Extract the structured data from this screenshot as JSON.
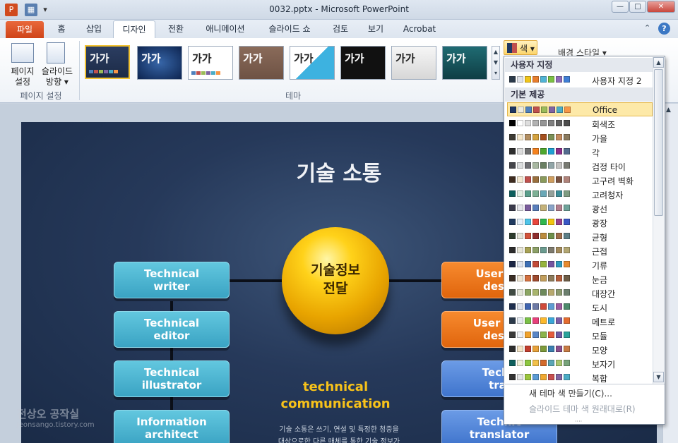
{
  "window": {
    "title": "0032.pptx  -  Microsoft PowerPoint"
  },
  "tabs": [
    {
      "label": "파일"
    },
    {
      "label": "홈"
    },
    {
      "label": "삽입"
    },
    {
      "label": "디자인"
    },
    {
      "label": "전환"
    },
    {
      "label": "애니메이션"
    },
    {
      "label": "슬라이드 쇼"
    },
    {
      "label": "검토"
    },
    {
      "label": "보기"
    },
    {
      "label": "Acrobat"
    }
  ],
  "ribbon": {
    "page_setup_label": "페이지\n설정",
    "orientation_label": "슬라이드\n방향 ▾",
    "group_page_setup": "페이지 설정",
    "group_theme": "테마",
    "colors_button": "색 ▾",
    "bg_style": "배경 스타일 ▾",
    "theme_sample": "가가"
  },
  "colors_menu": {
    "custom_header": "사용자 지정",
    "custom_item": "사용자 지정 2",
    "builtin_header": "기본 제공",
    "items": [
      {
        "name": "Office",
        "colors": [
          "#1f3864",
          "#eeece1",
          "#4f81bd",
          "#c0504d",
          "#9bbb59",
          "#8064a2",
          "#4bacc6",
          "#f79646"
        ]
      },
      {
        "name": "회색조",
        "colors": [
          "#000000",
          "#ffffff",
          "#dddddd",
          "#b2b2b2",
          "#969696",
          "#808080",
          "#5f5f5f",
          "#4d4d4d"
        ]
      },
      {
        "name": "가을",
        "colors": [
          "#3d3a33",
          "#f5e8cd",
          "#b28e60",
          "#d5a33f",
          "#a44f1d",
          "#7b8f56",
          "#c48b5e",
          "#8a7a5e"
        ]
      },
      {
        "name": "각",
        "colors": [
          "#2d2d2d",
          "#dcdcdc",
          "#6f6f6f",
          "#f5821f",
          "#4ea72e",
          "#1fa0d3",
          "#8b2f8b",
          "#546c8f"
        ]
      },
      {
        "name": "검정 타이",
        "colors": [
          "#44454a",
          "#dcdedf",
          "#6f6f74",
          "#a8b8a1",
          "#6a8063",
          "#91a5a7",
          "#c3c2c0",
          "#787a72"
        ]
      },
      {
        "name": "고구려 벽화",
        "colors": [
          "#3e2b1f",
          "#f4e8d1",
          "#c0504d",
          "#9a6f3d",
          "#8a9a5b",
          "#cf9e5f",
          "#7b5341",
          "#b0837a"
        ]
      },
      {
        "name": "고려청자",
        "colors": [
          "#0c5e5c",
          "#e3efe3",
          "#599e8a",
          "#7eb196",
          "#6aa8b7",
          "#95a19b",
          "#3c8d98",
          "#7f9c82"
        ]
      },
      {
        "name": "광선",
        "colors": [
          "#3a3a4b",
          "#e6e6ec",
          "#7a5c9c",
          "#5a7fbd",
          "#c4b27a",
          "#8aa3c7",
          "#b37f8f",
          "#6fa39a"
        ]
      },
      {
        "name": "광장",
        "colors": [
          "#1f3a60",
          "#e5f0fb",
          "#4ec4e9",
          "#e8463d",
          "#30b74e",
          "#f2c511",
          "#98418d",
          "#3a58c7"
        ]
      },
      {
        "name": "균형",
        "colors": [
          "#2d3b2d",
          "#e4e4d8",
          "#d2533b",
          "#8f2d2d",
          "#bb8b3d",
          "#6e8f4b",
          "#9e6d4a",
          "#5c7f87"
        ]
      },
      {
        "name": "근접",
        "colors": [
          "#2c2c2c",
          "#e8e6d8",
          "#a7a154",
          "#8ca067",
          "#6b9b8f",
          "#7e7a6d",
          "#a38b5d",
          "#b3a773"
        ]
      },
      {
        "name": "기류",
        "colors": [
          "#1b2645",
          "#dde3ee",
          "#3d6fb5",
          "#c24a38",
          "#96b33d",
          "#7454a0",
          "#2f99bd",
          "#e88a2f"
        ]
      },
      {
        "name": "눈금",
        "colors": [
          "#3a2d24",
          "#efe6d5",
          "#d3703f",
          "#9e4a2e",
          "#c29e5b",
          "#8d7a5a",
          "#b35d3b",
          "#6d5c46"
        ]
      },
      {
        "name": "대장간",
        "colors": [
          "#3f4a42",
          "#e2e5d7",
          "#8ba663",
          "#a9b56e",
          "#6e8a5c",
          "#b7a96f",
          "#8b9a6f",
          "#6b7f6e"
        ]
      },
      {
        "name": "도시",
        "colors": [
          "#1e2e4e",
          "#dfe3ec",
          "#3f64b0",
          "#6d7aa6",
          "#cf4a3a",
          "#5d9bd2",
          "#9d5a9e",
          "#4c8a6c"
        ]
      },
      {
        "name": "메트로",
        "colors": [
          "#2b3a4a",
          "#e4eaf0",
          "#7ac046",
          "#e8407b",
          "#fcb92c",
          "#3aa7d9",
          "#7b5ea8",
          "#e56c2f"
        ]
      },
      {
        "name": "모듈",
        "colors": [
          "#3a3a3a",
          "#eef1f5",
          "#f0a22c",
          "#5a86c6",
          "#8cb34b",
          "#e55b3c",
          "#6e59a3",
          "#2aa39b"
        ]
      },
      {
        "name": "모양",
        "colors": [
          "#2e2e2e",
          "#f5e6c8",
          "#c23e2e",
          "#e8a23a",
          "#7d9a3a",
          "#3c7fb0",
          "#8a4f8d",
          "#c97c45"
        ]
      },
      {
        "name": "보자기",
        "colors": [
          "#0f5f5c",
          "#f0f0d6",
          "#8cc63f",
          "#f2c14a",
          "#d26a2c",
          "#5aa6b5",
          "#a9c66e",
          "#77a37a"
        ]
      },
      {
        "name": "복합",
        "colors": [
          "#333333",
          "#e6e6e6",
          "#9bc53d",
          "#5b9bd5",
          "#f0a830",
          "#c64f4f",
          "#8064a2",
          "#4bacc6"
        ]
      }
    ],
    "create_new": "새 테마 색 만들기(C)...",
    "reset": "슬라이드 테마 색 원래대로(R)"
  },
  "custom_colors": [
    "#2b3a4a",
    "#dfe3ea",
    "#f0c419",
    "#e87d2c",
    "#4fb4d6",
    "#7bc043",
    "#8e6ab8",
    "#3f7ed6"
  ],
  "slide": {
    "title": "기술 소통",
    "center_label": "기술정보\n전달",
    "sub_title": "technical\ncommunication",
    "body": "기술 소통은 쓰기, 연설 및 특정한 청중을\n대상으로한 다른 매체를 통한 기술 정보가",
    "left_boxes": [
      "Technical\nwriter",
      "Technical\neditor",
      "Technical\nillustrator",
      "Information\narchitect"
    ],
    "right_boxes": [
      "User int\ndesig",
      "User exp\ndesig",
      "Techn\ntrai",
      "Technic\ntranslator"
    ]
  },
  "watermark": {
    "line1": "전상오 공작실",
    "line2": "jeonsango.tistory.com"
  }
}
